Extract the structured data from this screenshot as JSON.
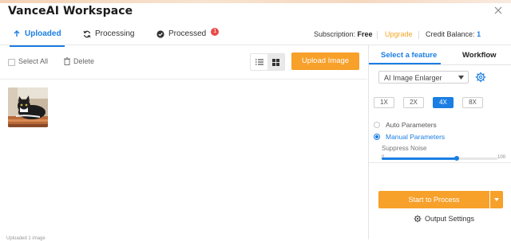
{
  "app": {
    "title": "VanceAI Workspace"
  },
  "tabs": [
    {
      "label": "Uploaded",
      "active": true
    },
    {
      "label": "Processing",
      "active": false
    },
    {
      "label": "Processed",
      "active": false,
      "badge": "1"
    }
  ],
  "account": {
    "subscription_label": "Subscription:",
    "subscription_value": "Free",
    "upgrade_label": "Upgrade",
    "credit_label": "Credit Balance:",
    "credit_value": "1"
  },
  "toolbar": {
    "select_all_label": "Select All",
    "delete_label": "Delete",
    "upload_label": "Upload Image"
  },
  "footer": {
    "text": "Uploaded 1 image"
  },
  "panel": {
    "tabs": [
      {
        "label": "Select a feature",
        "active": true
      },
      {
        "label": "Workflow",
        "active": false
      }
    ],
    "feature_selected": "AI Image Enlarger",
    "scales": [
      "1X",
      "2X",
      "4X",
      "8X"
    ],
    "scale_selected": "4X",
    "auto_params_label": "Auto Parameters",
    "manual_params_label": "Manual Parameters",
    "params_mode": "manual",
    "suppress_noise_label": "Suppress Noise",
    "noise_min": "0",
    "noise_max": "100",
    "noise_value": 65,
    "start_label": "Start to Process",
    "output_settings_label": "Output Settings"
  },
  "colors": {
    "accent": "#1a7ee2",
    "primary_button": "#f7a02a",
    "badge": "#e84a4a",
    "upgrade": "#f5a623"
  }
}
